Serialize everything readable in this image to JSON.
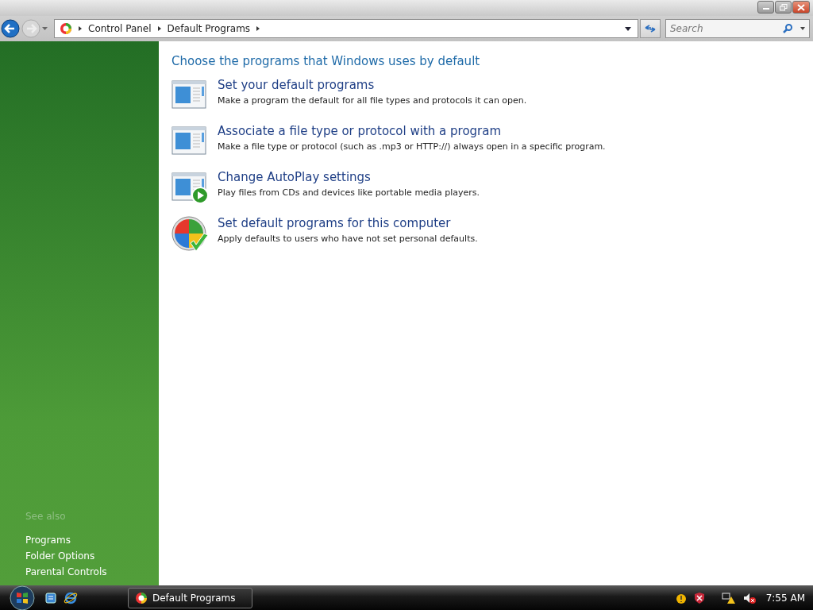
{
  "address_bar": {
    "breadcrumbs": [
      "Control Panel",
      "Default Programs"
    ]
  },
  "search": {
    "placeholder": "Search"
  },
  "heading": "Choose the programs that Windows uses by default",
  "tasks": [
    {
      "kind": "window",
      "title": "Set your default programs",
      "description": "Make a program the default for all file types and protocols it can open."
    },
    {
      "kind": "window",
      "title": "Associate a file type or protocol with a program",
      "description": "Make a file type or protocol (such as .mp3 or HTTP://) always open in a specific program."
    },
    {
      "kind": "autoplay",
      "title": "Change AutoPlay settings",
      "description": "Play files from CDs and devices like portable media players."
    },
    {
      "kind": "shield",
      "title": "Set default programs for this computer",
      "description": "Apply defaults to users who have not set personal defaults."
    }
  ],
  "see_also": {
    "heading": "See also",
    "links": [
      "Programs",
      "Folder Options",
      "Parental Controls"
    ]
  },
  "taskbar": {
    "window_button": "Default Programs",
    "clock": "7:55 AM"
  }
}
